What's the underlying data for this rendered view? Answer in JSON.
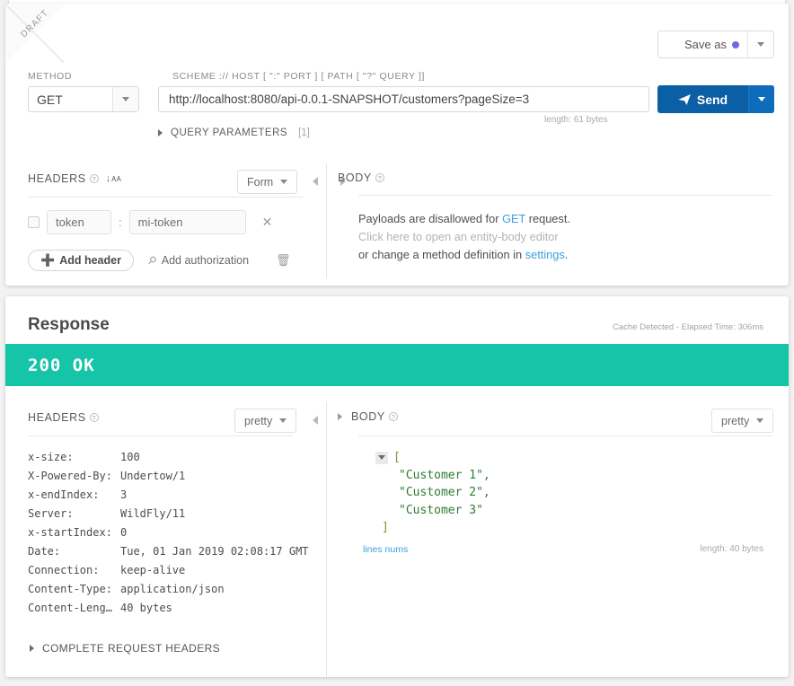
{
  "request": {
    "ribbon": "DRAFT",
    "method_label": "METHOD",
    "method_value": "GET",
    "url_label": "SCHEME :// HOST [ \":\" PORT ] [ PATH [ \"?\" QUERY ]]",
    "url_value": "http://localhost:8080/api-0.0.1-SNAPSHOT/customers?pageSize=3",
    "url_length": "length: 61 bytes",
    "save_as_label": "Save as",
    "send_label": "Send",
    "query_parameters_label": "QUERY PARAMETERS",
    "query_parameters_count": "[1]",
    "headers": {
      "title": "HEADERS",
      "view_mode": "Form",
      "rows": [
        {
          "key": "token",
          "separator": ":",
          "value": "mi-token"
        }
      ],
      "add_header_label": "Add header",
      "add_authorization_label": "Add authorization"
    },
    "body": {
      "title": "BODY",
      "line1_prefix": "Payloads are disallowed for ",
      "line1_link": "GET",
      "line1_suffix": " request.",
      "line2": "Click here to open an entity-body editor",
      "line3_prefix": "or change a method definition in ",
      "line3_link": "settings",
      "line3_suffix": "."
    }
  },
  "response": {
    "title": "Response",
    "cache_info": "Cache Detected - Elapsed Time: 306ms",
    "status": "200 OK",
    "status_color": "#16c4a8",
    "headers": {
      "title": "HEADERS",
      "view_mode": "pretty",
      "rows": [
        {
          "key": "x-size:",
          "value": "100"
        },
        {
          "key": "X-Powered-By:",
          "value": "Undertow/1"
        },
        {
          "key": "x-endIndex:",
          "value": "3"
        },
        {
          "key": "Server:",
          "value": "WildFly/11"
        },
        {
          "key": "x-startIndex:",
          "value": "0"
        },
        {
          "key": "Date:",
          "value": "Tue, 01 Jan 2019 02:08:17 GMT"
        },
        {
          "key": "Connection:",
          "value": "keep-alive"
        },
        {
          "key": "Content-Type:",
          "value": "application/json"
        },
        {
          "key": "Content-Leng…",
          "value": "40 bytes"
        }
      ]
    },
    "body": {
      "title": "BODY",
      "view_mode": "pretty",
      "open_bracket": "[",
      "items": [
        "\"Customer 1\",",
        "\"Customer 2\",",
        "\"Customer 3\""
      ],
      "close_bracket": "]",
      "lines_nums_label": "lines nums",
      "length": "length: 40 bytes"
    },
    "complete_request_headers_label": "COMPLETE REQUEST HEADERS"
  }
}
